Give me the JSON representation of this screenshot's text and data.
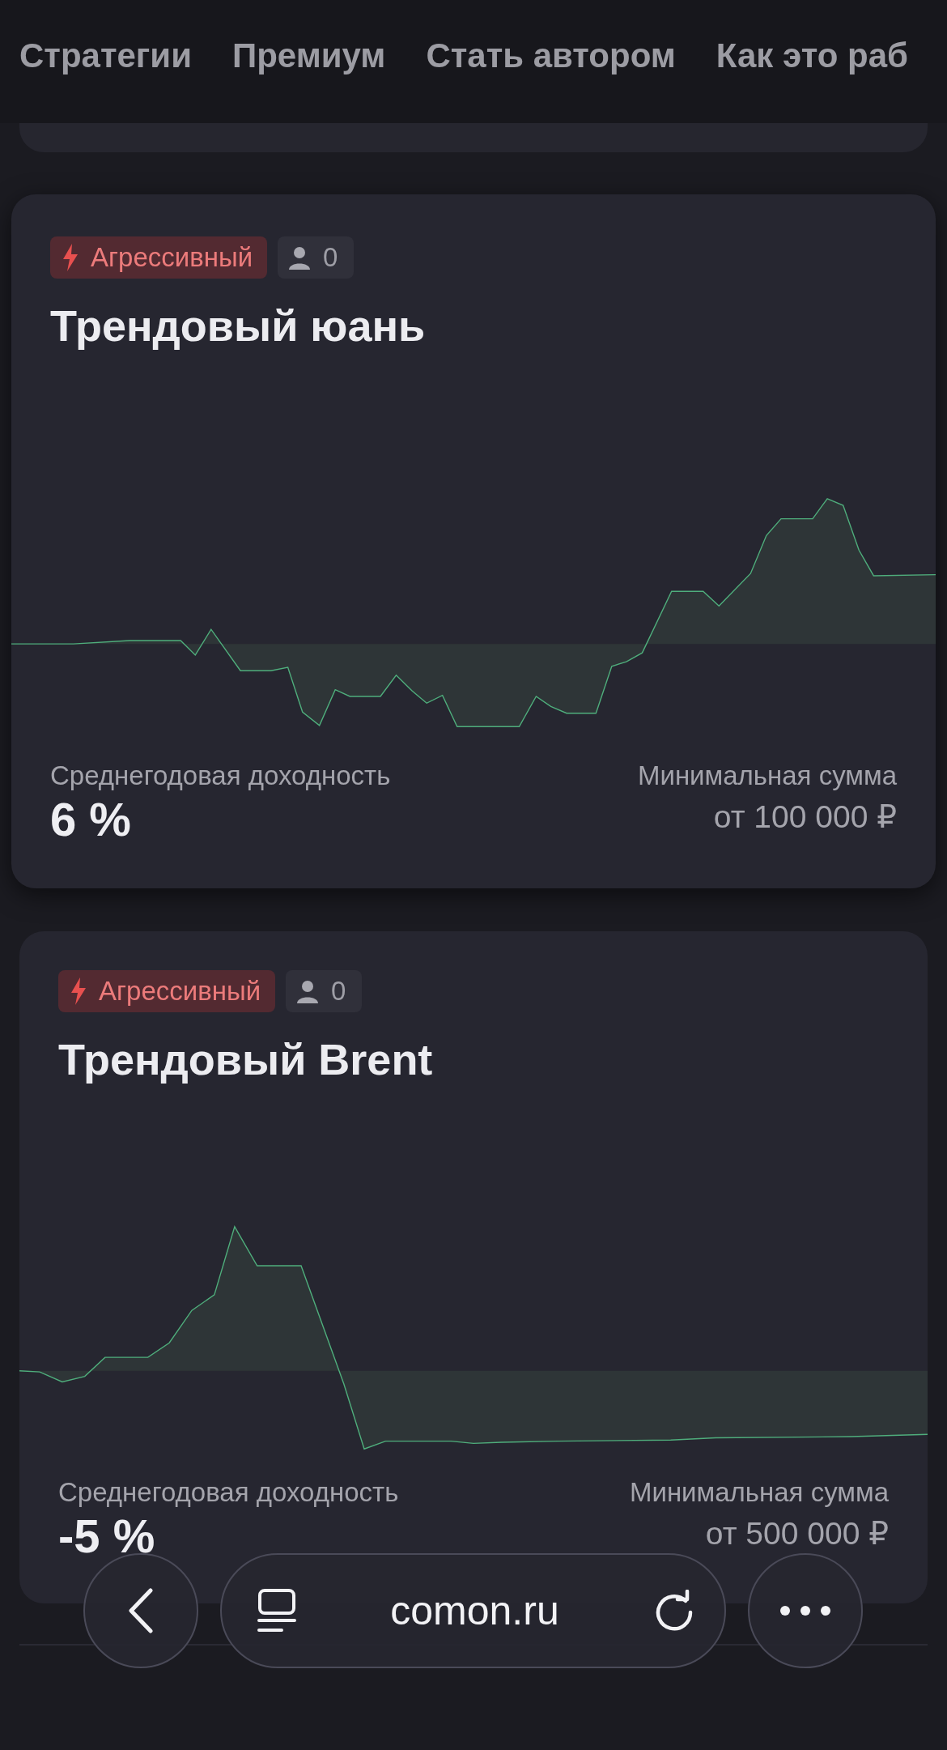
{
  "nav": {
    "items": [
      {
        "label": "Стратегии"
      },
      {
        "label": "Премиум"
      },
      {
        "label": "Стать автором"
      },
      {
        "label": "Как это раб"
      }
    ]
  },
  "cards": [
    {
      "risk": {
        "kind": "aggressive",
        "label": "Агрессивный"
      },
      "subscribers": "0",
      "title": "Трендовый юань",
      "lifted": true,
      "yield_label": "Среднегодовая доходность",
      "yield_value": "6 %",
      "min_label": "Минимальная сумма",
      "min_value": "от 100 000 ₽"
    },
    {
      "risk": {
        "kind": "aggressive",
        "label": "Агрессивный"
      },
      "subscribers": "0",
      "title": "Трендовый Brent",
      "lifted": false,
      "yield_label": "Среднегодовая доходность",
      "yield_value": "-5 %",
      "min_label": "Минимальная сумма",
      "min_value": "от 500 000 ₽"
    }
  ],
  "browser_bar": {
    "url": "comon.ru"
  }
}
